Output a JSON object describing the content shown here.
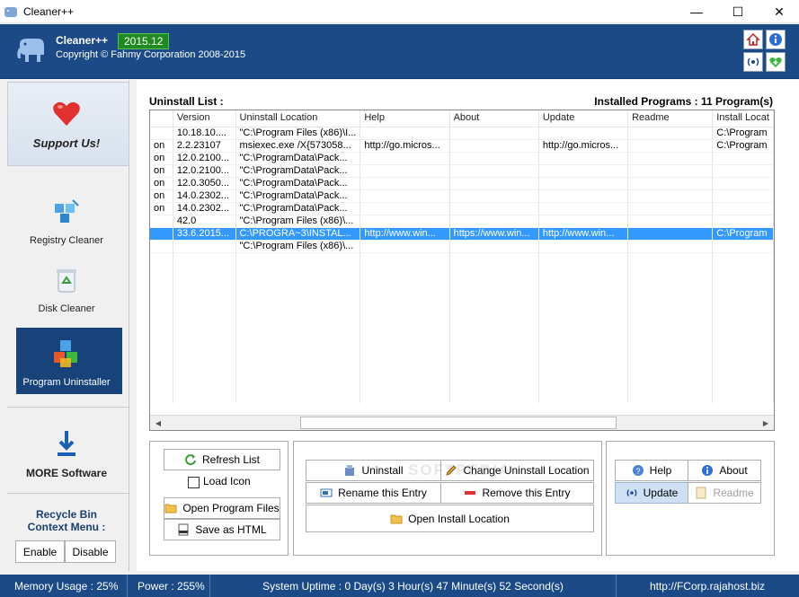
{
  "window": {
    "title": "Cleaner++",
    "minimize": "—",
    "maximize": "☐",
    "close": "✕"
  },
  "header": {
    "app_name": "Cleaner++",
    "version": "2015.12",
    "copyright": "Copyright © Fahmy Corporation 2008-2015"
  },
  "sidebar": {
    "support": "Support Us!",
    "registry": "Registry Cleaner",
    "disk": "Disk Cleaner",
    "uninstaller": "Program Uninstaller",
    "more": "MORE Software",
    "recycle_title_1": "Recycle Bin",
    "recycle_title_2": "Context Menu :",
    "enable": "Enable",
    "disable": "Disable"
  },
  "main": {
    "list_title": "Uninstall List :",
    "installed": "Installed Programs : 11 Program(s)",
    "columns": [
      "",
      "Version",
      "Uninstall Location",
      "Help",
      "About",
      "Update",
      "Readme",
      "Install Locat"
    ],
    "rows": [
      [
        "",
        "10.18.10....",
        "\"C:\\Program Files (x86)\\I...",
        "",
        "",
        "",
        "",
        "C:\\Program"
      ],
      [
        "on",
        "2.2.23107",
        "msiexec.exe /X{573058...",
        "http://go.micros...",
        "",
        "http://go.micros...",
        "",
        "C:\\Program"
      ],
      [
        "on",
        "12.0.2100...",
        "\"C:\\ProgramData\\Pack...",
        "",
        "",
        "",
        "",
        ""
      ],
      [
        "on",
        "12.0.2100...",
        "\"C:\\ProgramData\\Pack...",
        "",
        "",
        "",
        "",
        ""
      ],
      [
        "on",
        "12.0.3050...",
        "\"C:\\ProgramData\\Pack...",
        "",
        "",
        "",
        "",
        ""
      ],
      [
        "on",
        "14.0.2302...",
        "\"C:\\ProgramData\\Pack...",
        "",
        "",
        "",
        "",
        ""
      ],
      [
        "on",
        "14.0.2302...",
        "\"C:\\ProgramData\\Pack...",
        "",
        "",
        "",
        "",
        ""
      ],
      [
        "",
        "42.0",
        "\"C:\\Program Files (x86)\\...",
        "",
        "",
        "",
        "",
        ""
      ],
      [
        "",
        "33.6.2015...",
        "C:\\PROGRA~3\\INSTAL...",
        "http://www.win...",
        "https://www.win...",
        "http://www.win...",
        "",
        "C:\\Program"
      ],
      [
        "",
        "",
        "\"C:\\Program Files (x86)\\...",
        "",
        "",
        "",
        "",
        ""
      ]
    ],
    "selected_row": 8
  },
  "actions": {
    "refresh": "Refresh List",
    "load_icon": "Load Icon",
    "open_files": "Open Program Files",
    "save_html": "Save as HTML",
    "uninstall": "Uninstall",
    "change_loc": "Change Uninstall Location",
    "rename": "Rename this Entry",
    "remove": "Remove this Entry",
    "open_install": "Open Install Location",
    "help": "Help",
    "about": "About",
    "update": "Update",
    "readme": "Readme"
  },
  "status": {
    "memory": "Memory Usage : 25%",
    "power": "Power : 255%",
    "uptime": "System Uptime : 0 Day(s) 3 Hour(s) 47 Minute(s) 52 Second(s)",
    "url": "http://FCorp.rajahost.biz"
  },
  "watermark": "SOFTPEDIA",
  "colors": {
    "header": "#1b4a86",
    "selection": "#3399ff",
    "version_badge": "#1f8a22"
  }
}
